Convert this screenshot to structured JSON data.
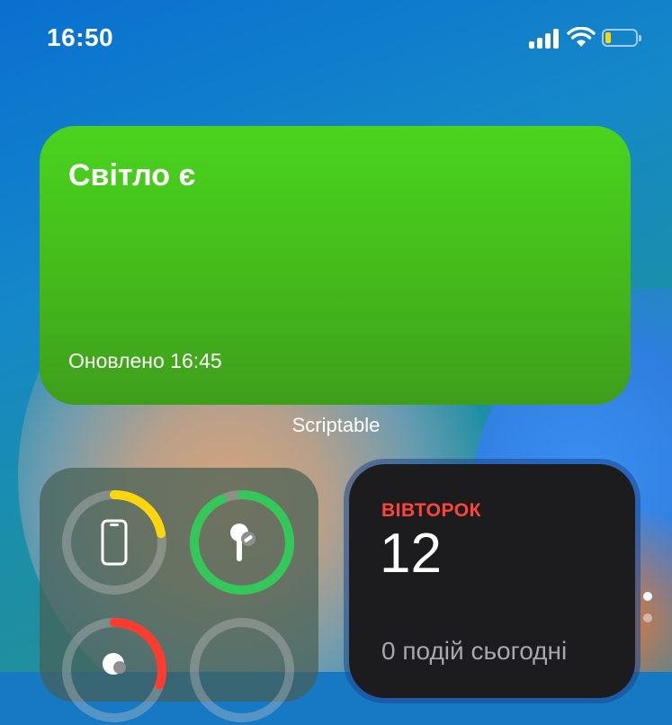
{
  "status_bar": {
    "time": "16:50",
    "signal_icon": "cellular-signal-icon",
    "wifi_icon": "wifi-icon",
    "battery_icon": "battery-icon",
    "battery_color": "#ffd60a"
  },
  "scriptable_widget": {
    "title": "Світло є",
    "updated": "Оновлено 16:45",
    "background_color": "#44c11d",
    "caption": "Scriptable"
  },
  "batteries_widget": {
    "devices": [
      {
        "icon": "iphone-icon",
        "level": 0.22,
        "ring_color": "#ffd60a"
      },
      {
        "icon": "airpod-icon",
        "level": 0.93,
        "ring_color": "#34c759"
      },
      {
        "icon": "airpods-case-icon",
        "level": 0.3,
        "ring_color": "#ff3b30"
      },
      {
        "icon": "empty-slot",
        "level": 0,
        "ring_color": "#8e8e93"
      }
    ]
  },
  "calendar_widget": {
    "weekday": "ВІВТОРОК",
    "date": "12",
    "events": "0 подій сьогодні",
    "weekday_color": "#ff453a"
  },
  "page_indicator": {
    "pages": 2,
    "current": 1
  }
}
